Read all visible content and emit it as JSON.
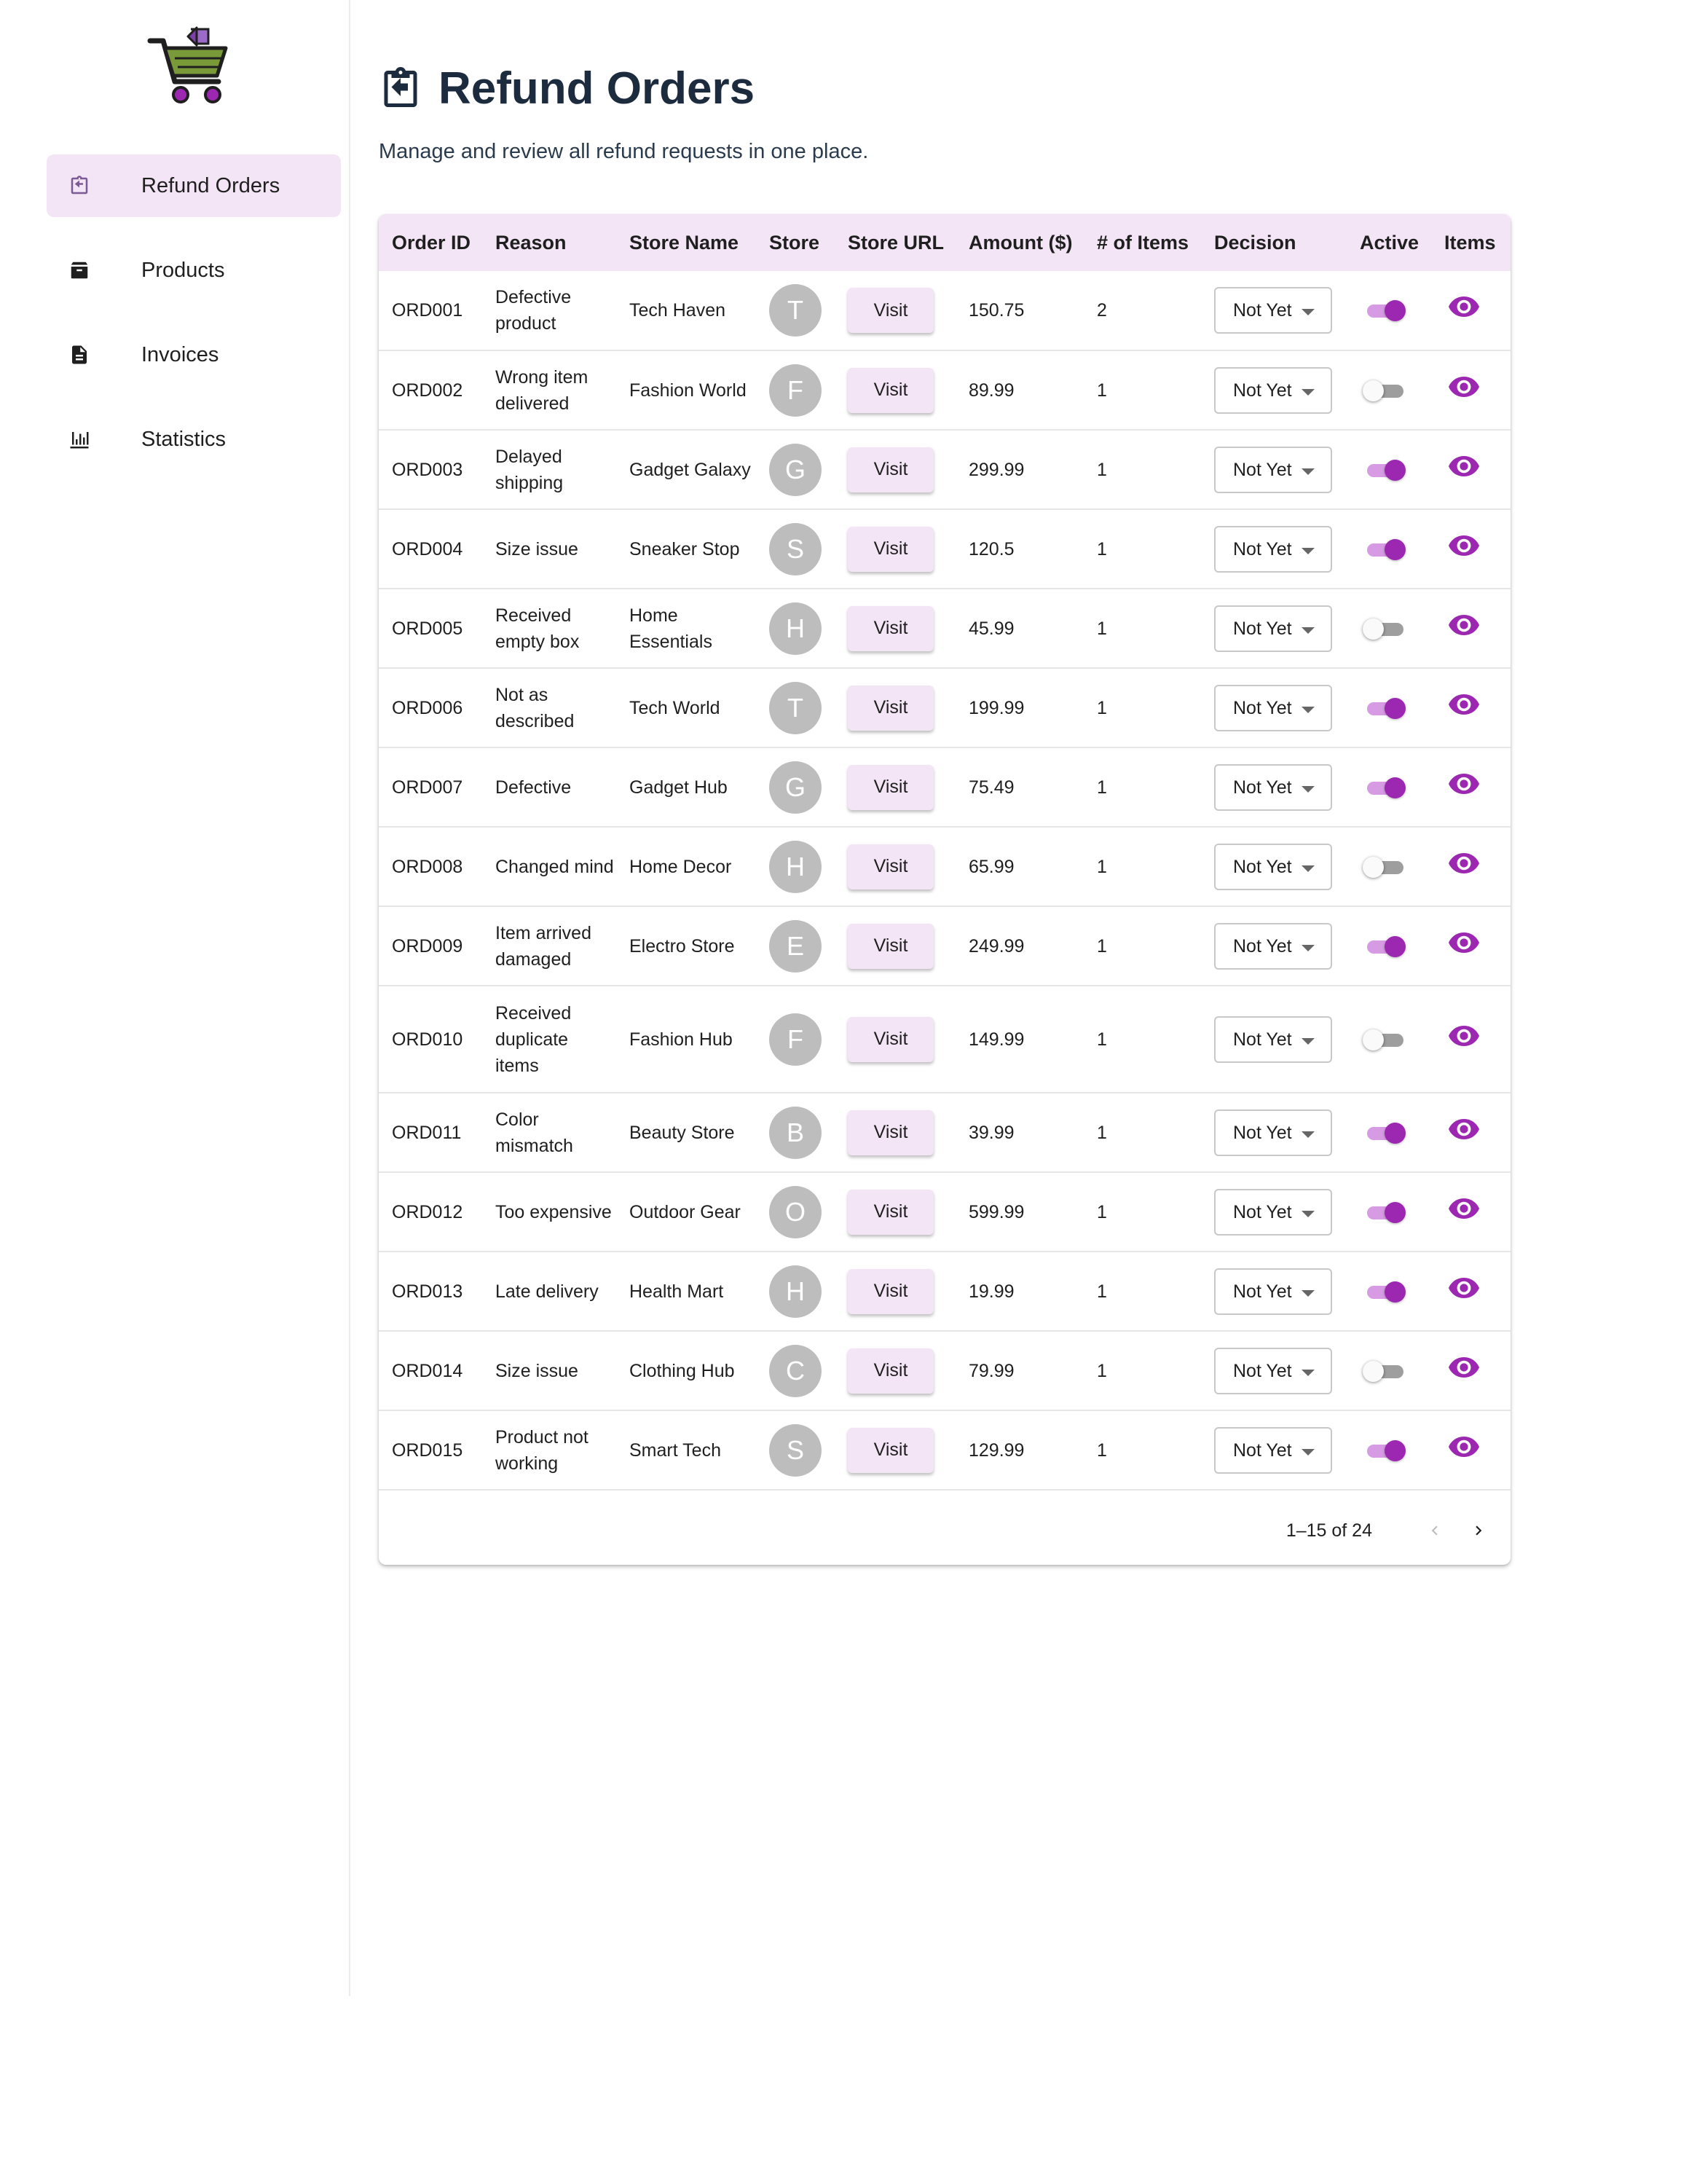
{
  "sidebar": {
    "logo_icon": "shopping-cart-return-logo",
    "items": [
      {
        "label": "Refund Orders",
        "icon": "refund-orders-icon",
        "active": true
      },
      {
        "label": "Products",
        "icon": "products-box-icon",
        "active": false
      },
      {
        "label": "Invoices",
        "icon": "invoice-document-icon",
        "active": false
      },
      {
        "label": "Statistics",
        "icon": "statistics-chart-icon",
        "active": false
      }
    ]
  },
  "header": {
    "title": "Refund Orders",
    "subtitle": "Manage and review all refund requests in one place."
  },
  "table": {
    "columns": [
      "Order ID",
      "Reason",
      "Store Name",
      "Store",
      "Store URL",
      "Amount ($)",
      "# of Items",
      "Decision",
      "Active",
      "Items"
    ],
    "visit_label": "Visit",
    "rows": [
      {
        "order_id": "ORD001",
        "reason": "Defective product",
        "store_name": "Tech Haven",
        "store_initial": "T",
        "amount": "150.75",
        "items": "2",
        "decision": "Not Yet",
        "active": true
      },
      {
        "order_id": "ORD002",
        "reason": "Wrong item delivered",
        "store_name": "Fashion World",
        "store_initial": "F",
        "amount": "89.99",
        "items": "1",
        "decision": "Not Yet",
        "active": false
      },
      {
        "order_id": "ORD003",
        "reason": "Delayed shipping",
        "store_name": "Gadget Galaxy",
        "store_initial": "G",
        "amount": "299.99",
        "items": "1",
        "decision": "Not Yet",
        "active": true
      },
      {
        "order_id": "ORD004",
        "reason": "Size issue",
        "store_name": "Sneaker Stop",
        "store_initial": "S",
        "amount": "120.5",
        "items": "1",
        "decision": "Not Yet",
        "active": true
      },
      {
        "order_id": "ORD005",
        "reason": "Received empty box",
        "store_name": "Home Essentials",
        "store_initial": "H",
        "amount": "45.99",
        "items": "1",
        "decision": "Not Yet",
        "active": false
      },
      {
        "order_id": "ORD006",
        "reason": "Not as described",
        "store_name": "Tech World",
        "store_initial": "T",
        "amount": "199.99",
        "items": "1",
        "decision": "Not Yet",
        "active": true
      },
      {
        "order_id": "ORD007",
        "reason": "Defective",
        "store_name": "Gadget Hub",
        "store_initial": "G",
        "amount": "75.49",
        "items": "1",
        "decision": "Not Yet",
        "active": true
      },
      {
        "order_id": "ORD008",
        "reason": "Changed mind",
        "store_name": "Home Decor",
        "store_initial": "H",
        "amount": "65.99",
        "items": "1",
        "decision": "Not Yet",
        "active": false
      },
      {
        "order_id": "ORD009",
        "reason": "Item arrived damaged",
        "store_name": "Electro Store",
        "store_initial": "E",
        "amount": "249.99",
        "items": "1",
        "decision": "Not Yet",
        "active": true
      },
      {
        "order_id": "ORD010",
        "reason": "Received duplicate items",
        "store_name": "Fashion Hub",
        "store_initial": "F",
        "amount": "149.99",
        "items": "1",
        "decision": "Not Yet",
        "active": false
      },
      {
        "order_id": "ORD011",
        "reason": "Color mismatch",
        "store_name": "Beauty Store",
        "store_initial": "B",
        "amount": "39.99",
        "items": "1",
        "decision": "Not Yet",
        "active": true
      },
      {
        "order_id": "ORD012",
        "reason": "Too expensive",
        "store_name": "Outdoor Gear",
        "store_initial": "O",
        "amount": "599.99",
        "items": "1",
        "decision": "Not Yet",
        "active": true
      },
      {
        "order_id": "ORD013",
        "reason": "Late delivery",
        "store_name": "Health Mart",
        "store_initial": "H",
        "amount": "19.99",
        "items": "1",
        "decision": "Not Yet",
        "active": true
      },
      {
        "order_id": "ORD014",
        "reason": "Size issue",
        "store_name": "Clothing Hub",
        "store_initial": "C",
        "amount": "79.99",
        "items": "1",
        "decision": "Not Yet",
        "active": false
      },
      {
        "order_id": "ORD015",
        "reason": "Product not working",
        "store_name": "Smart Tech",
        "store_initial": "S",
        "amount": "129.99",
        "items": "1",
        "decision": "Not Yet",
        "active": true
      }
    ]
  },
  "pagination": {
    "range_text": "1–15 of 24",
    "prev_icon": "chevron-left-icon",
    "next_icon": "chevron-right-icon"
  },
  "colors": {
    "accent": "#9c27b0",
    "accent_light": "#f3e5f5",
    "title": "#1c2b3d",
    "avatar": "#bdbdbd"
  }
}
